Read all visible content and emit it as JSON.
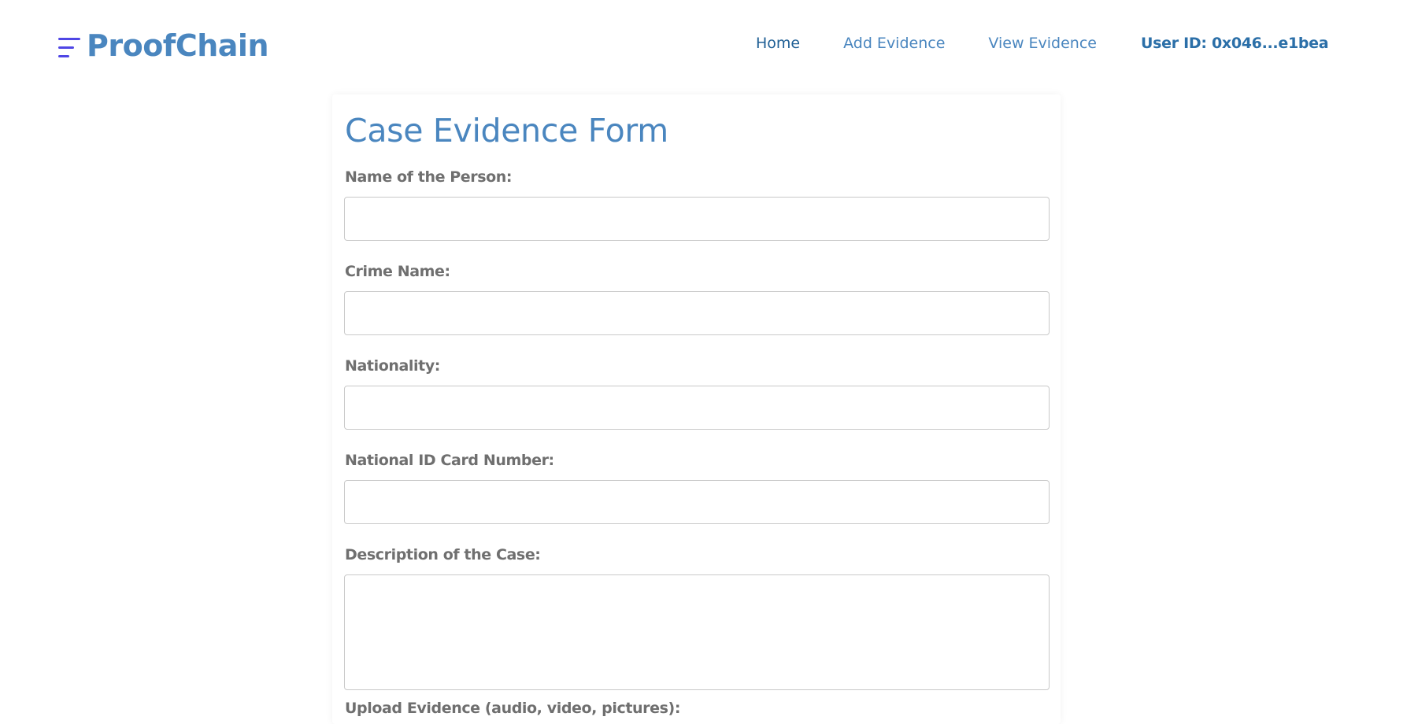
{
  "brand": {
    "name": "ProofChain",
    "icon": "menu-lines-icon",
    "icon_color": "#4f46e5",
    "text_color": "#4a86bf"
  },
  "nav": {
    "items": [
      {
        "label": "Home"
      },
      {
        "label": "Add Evidence"
      },
      {
        "label": "View Evidence"
      }
    ],
    "user_id": "User ID: 0x046...e1bea"
  },
  "form": {
    "title": "Case Evidence Form",
    "fields": [
      {
        "label": "Name of the Person:",
        "value": "",
        "placeholder": ""
      },
      {
        "label": "Crime Name:",
        "value": "",
        "placeholder": ""
      },
      {
        "label": "Nationality:",
        "value": "",
        "placeholder": ""
      },
      {
        "label": "National ID Card Number:",
        "value": "",
        "placeholder": ""
      },
      {
        "label": "Description of the Case:",
        "value": "",
        "placeholder": ""
      },
      {
        "label": "Upload Evidence (audio, video, pictures):"
      }
    ]
  }
}
